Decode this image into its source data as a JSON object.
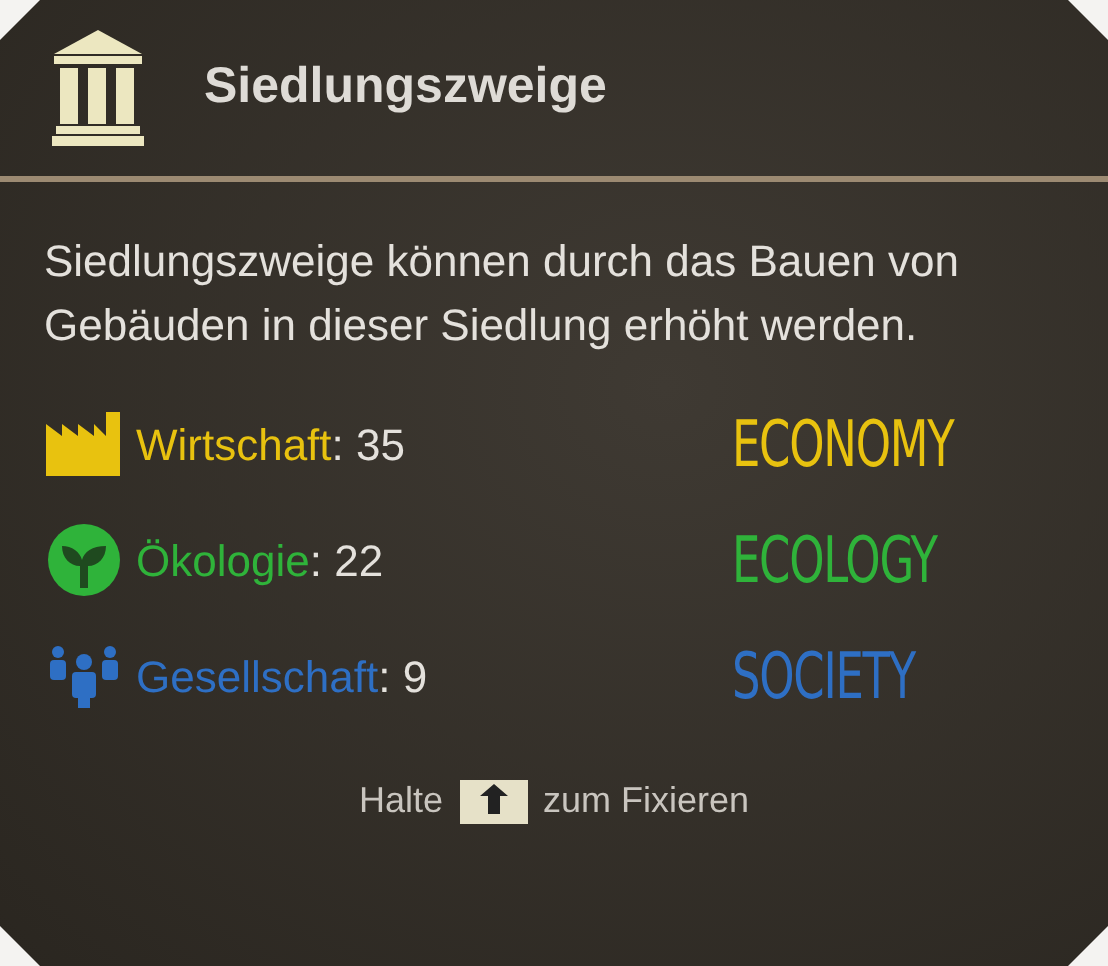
{
  "header": {
    "title": "Siedlungszweige"
  },
  "description": "Siedlungszweige können durch das Bauen von Gebäuden in dieser Siedlung erhöht werden.",
  "branches": [
    {
      "kind": "economy",
      "label": "Wirtschaft",
      "separator": ":",
      "value": "35",
      "tag": "ECONOMY",
      "color": "#e8c20f"
    },
    {
      "kind": "ecology",
      "label": "Ökologie",
      "separator": ":",
      "value": "22",
      "tag": "ECOLOGY",
      "color": "#2fb33a"
    },
    {
      "kind": "society",
      "label": "Gesellschaft",
      "separator": ":",
      "value": "9",
      "tag": "SOCIETY",
      "color": "#2e6fc4"
    }
  ],
  "footer": {
    "before": "Halte",
    "after": "zum Fixieren"
  }
}
